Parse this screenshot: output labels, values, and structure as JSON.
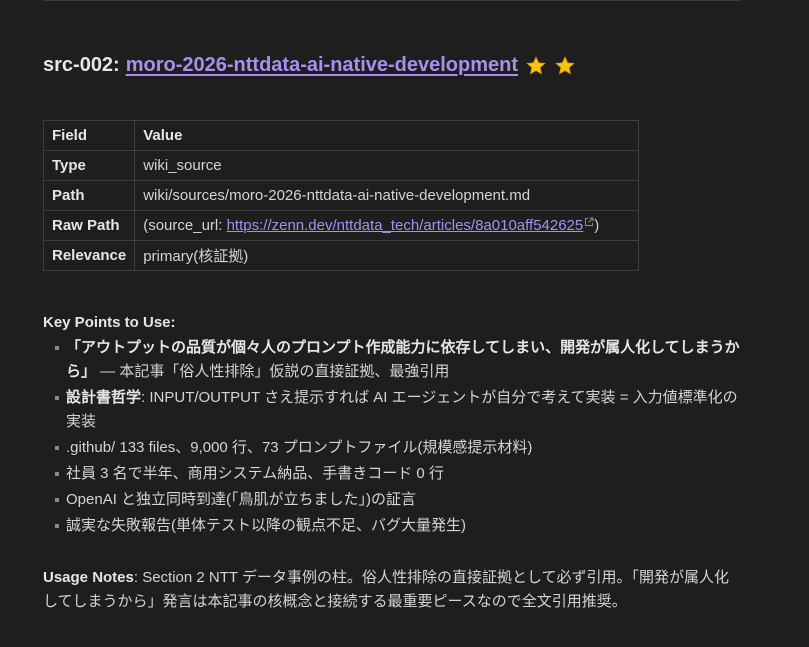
{
  "heading": {
    "prefix": "src-002:",
    "link_text": "moro-2026-nttdata-ai-native-development",
    "stars": [
      "star-icon",
      "star-icon"
    ]
  },
  "table": {
    "headers": [
      "Field",
      "Value"
    ],
    "rows": [
      {
        "field": "Type",
        "value": "wiki_source"
      },
      {
        "field": "Path",
        "value": "wiki/sources/moro-2026-nttdata-ai-native-development.md"
      },
      {
        "field": "Raw Path",
        "value_prefix": "(source_url: ",
        "value_link": "https://zenn.dev/nttdata_tech/articles/8a010aff542625",
        "value_suffix": ")"
      },
      {
        "field": "Relevance",
        "value": "primary(核証拠)"
      }
    ]
  },
  "key_points": {
    "title": "Key Points to Use:",
    "items": [
      {
        "bold": "「アウトプットの品質が個々人のプロンプト作成能力に依存してしまい、開発が属人化してしまうから」",
        "text": " — 本記事「俗人性排除」仮説の直接証拠、最強引用"
      },
      {
        "bold": "設計書哲学",
        "text": ": INPUT/OUTPUT さえ提示すれば AI エージェントが自分で考えて実装 = 入力値標準化の実装"
      },
      {
        "bold": "",
        "text": ".github/ 133 files、9,000 行、73 プロンプトファイル(規模感提示材料)"
      },
      {
        "bold": "",
        "text": "社員 3 名で半年、商用システム納品、手書きコード 0 行"
      },
      {
        "bold": "",
        "text": "OpenAI と独立同時到達(「鳥肌が立ちました」)の証言"
      },
      {
        "bold": "",
        "text": "誠実な失敗報告(単体テスト以降の観点不足、バグ大量発生)"
      }
    ]
  },
  "usage": {
    "label": "Usage Notes",
    "text": ": Section 2 NTT データ事例の柱。俗人性排除の直接証拠として必ず引用。「開発が属人化してしまうから」発言は本記事の核概念と接続する最重要ピースなので全文引用推奨。"
  },
  "colors": {
    "background": "#1e1e1e",
    "link": "#a98ef0",
    "border": "#3e3e3e",
    "star": "#f5c518"
  }
}
